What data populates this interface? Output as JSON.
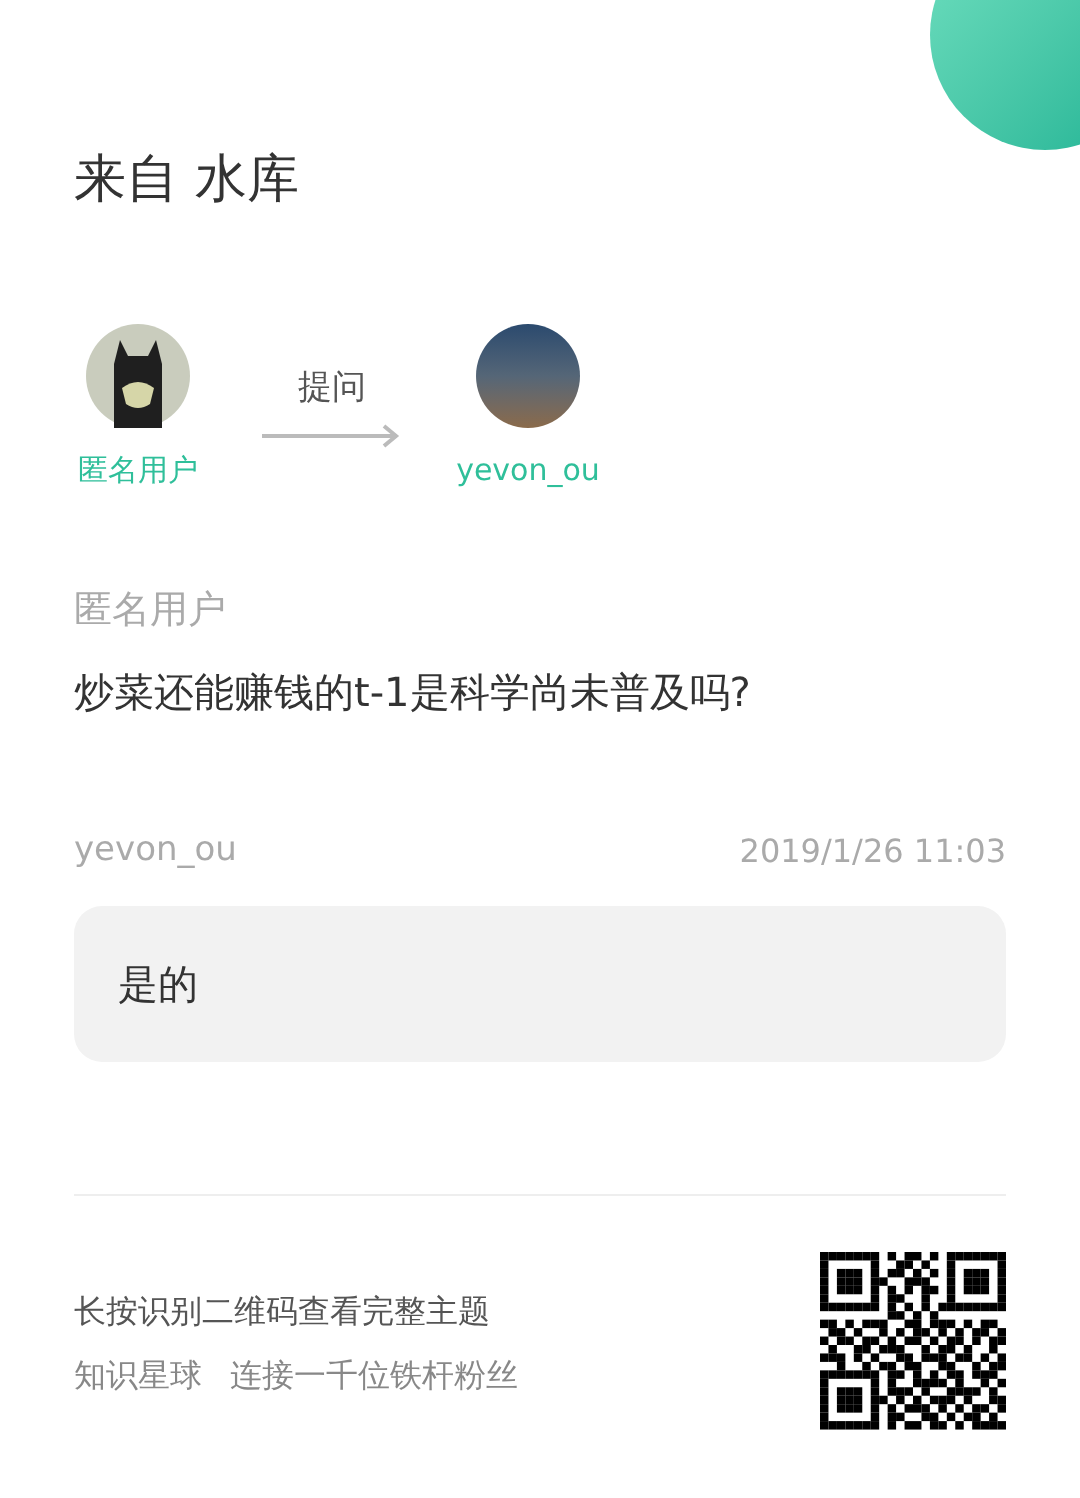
{
  "header": {
    "title": "来自 水库"
  },
  "flow": {
    "from": {
      "name": "匿名用户"
    },
    "action": "提问",
    "to": {
      "name": "yevon_ou"
    }
  },
  "question": {
    "author": "匿名用户",
    "text": "炒菜还能赚钱的t-1是科学尚未普及吗?"
  },
  "answer": {
    "author": "yevon_ou",
    "time": "2019/1/26 11:03",
    "text": "是的"
  },
  "footer": {
    "hint": "长按识别二维码查看完整主题",
    "brand": "知识星球",
    "slogan": "连接一千位铁杆粉丝"
  }
}
